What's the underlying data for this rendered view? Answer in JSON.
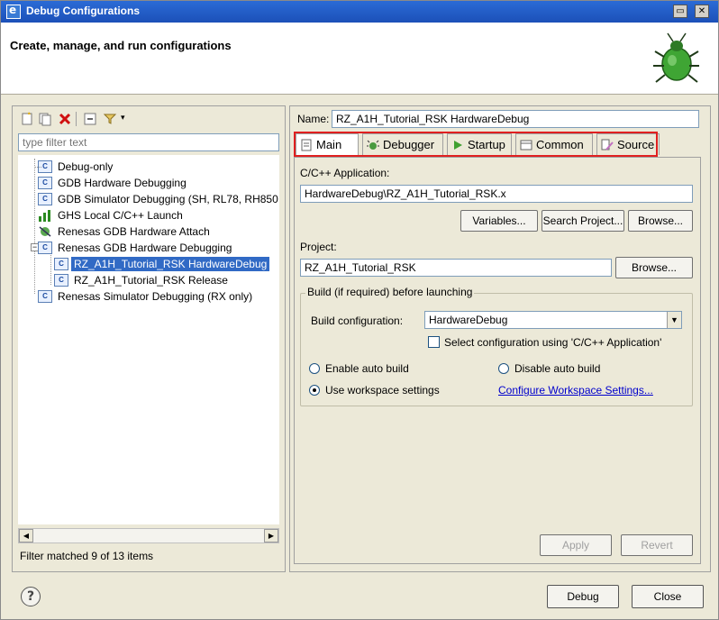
{
  "window": {
    "title": "Debug Configurations",
    "header": "Create, manage, and run configurations",
    "controls": [
      "restore",
      "close"
    ]
  },
  "left": {
    "toolbar_icons": [
      "new-config-icon",
      "duplicate-icon",
      "delete-icon",
      "collapse-all-icon",
      "filter-icon",
      "dropdown-arrow-icon"
    ],
    "filter_placeholder": "type filter text",
    "tree": [
      {
        "label": "Debug-only",
        "level": 1,
        "icon": "c-config-icon"
      },
      {
        "label": "GDB Hardware Debugging",
        "level": 1,
        "icon": "c-config-icon"
      },
      {
        "label": "GDB Simulator Debugging (SH, RL78, RH850",
        "level": 1,
        "icon": "c-config-icon"
      },
      {
        "label": "GHS Local C/C++ Launch",
        "level": 1,
        "icon": "ghs-icon"
      },
      {
        "label": "Renesas GDB Hardware Attach",
        "level": 1,
        "icon": "attach-icon"
      },
      {
        "label": "Renesas GDB Hardware Debugging",
        "level": 1,
        "icon": "c-config-icon",
        "expanded": true
      },
      {
        "label": "RZ_A1H_Tutorial_RSK HardwareDebug",
        "level": 2,
        "icon": "c-config-icon",
        "selected": true
      },
      {
        "label": "RZ_A1H_Tutorial_RSK Release",
        "level": 2,
        "icon": "c-config-icon"
      },
      {
        "label": "Renesas Simulator Debugging (RX only)",
        "level": 1,
        "icon": "c-config-icon"
      }
    ],
    "status": "Filter matched 9 of 13 items"
  },
  "right": {
    "name_label": "Name:",
    "name_value": "RZ_A1H_Tutorial_RSK HardwareDebug",
    "tabs": [
      {
        "label": "Main",
        "icon": "main-tab-icon",
        "active": true
      },
      {
        "label": "Debugger",
        "icon": "debugger-tab-icon"
      },
      {
        "label": "Startup",
        "icon": "startup-tab-icon"
      },
      {
        "label": "Common",
        "icon": "common-tab-icon"
      },
      {
        "label": "Source",
        "icon": "source-tab-icon"
      }
    ],
    "app_label": "C/C++ Application:",
    "app_value": "HardwareDebug\\RZ_A1H_Tutorial_RSK.x",
    "variables_btn": "Variables...",
    "search_project_btn": "Search Project...",
    "browse_btn": "Browse...",
    "project_label": "Project:",
    "project_value": "RZ_A1H_Tutorial_RSK",
    "project_browse_btn": "Browse...",
    "build_group_title": "Build (if required) before launching",
    "build_config_label": "Build configuration:",
    "build_config_value": "HardwareDebug",
    "select_config_checkbox": "Select configuration using 'C/C++ Application'",
    "select_config_checked": false,
    "enable_auto_build": "Enable auto build",
    "disable_auto_build": "Disable auto build",
    "use_workspace": "Use workspace settings",
    "configure_link": "Configure Workspace Settings...",
    "selected_radio": "use_workspace",
    "apply_btn": "Apply",
    "revert_btn": "Revert"
  },
  "footer": {
    "debug_btn": "Debug",
    "close_btn": "Close"
  }
}
